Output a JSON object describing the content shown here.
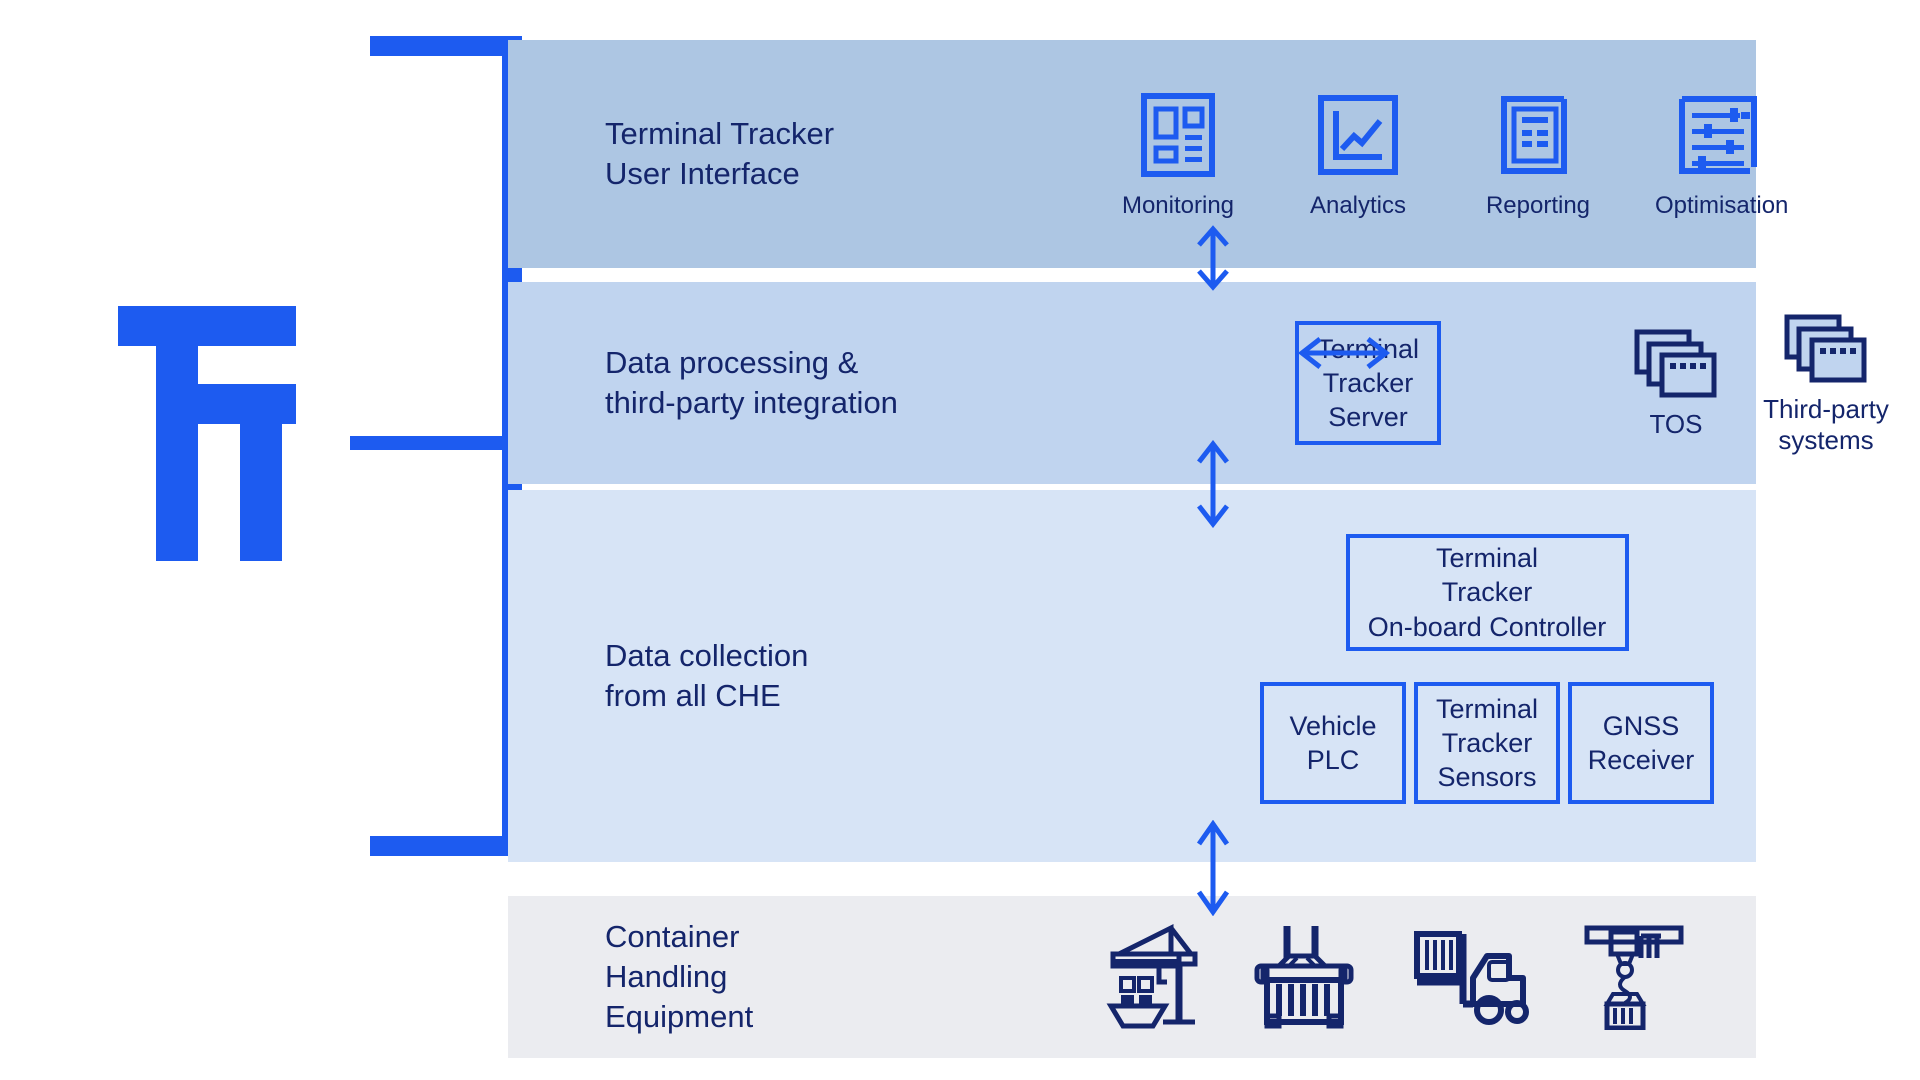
{
  "colors": {
    "brand_blue": "#1d5bf0",
    "navy": "#14256b",
    "band_ui": "#adc6e3",
    "band_processing": "#c0d4ef",
    "band_collection": "#d7e4f6",
    "band_che": "#ebecf0"
  },
  "logo": {
    "name": "terminal-tracker-tt-monogram"
  },
  "bands": {
    "ui": {
      "label": "Terminal Tracker\nUser Interface",
      "items": [
        {
          "icon": "dashboard-monitoring-icon",
          "label": "Monitoring"
        },
        {
          "icon": "line-chart-analytics-icon",
          "label": "Analytics"
        },
        {
          "icon": "document-reporting-icon",
          "label": "Reporting"
        },
        {
          "icon": "sliders-optimisation-icon",
          "label": "Optimisation"
        }
      ]
    },
    "processing": {
      "label": "Data processing &\nthird-party integration",
      "server_box": "Terminal\nTracker\nServer",
      "systems": [
        {
          "icon": "stacked-windows-icon",
          "label": "TOS"
        },
        {
          "icon": "stacked-windows-icon",
          "label": "Third-party\nsystems"
        }
      ]
    },
    "collection": {
      "label": "Data collection\nfrom all CHE",
      "controller_box": "Terminal\nTracker\nOn-board Controller",
      "devices": [
        "Vehicle\nPLC",
        "Terminal\nTracker\nSensors",
        "GNSS\nReceiver"
      ]
    },
    "che": {
      "label": "Container\nHandling\nEquipment",
      "items": [
        {
          "icon": "ship-to-shore-crane-icon"
        },
        {
          "icon": "container-spreader-icon"
        },
        {
          "icon": "forklift-reach-stacker-icon"
        },
        {
          "icon": "gantry-crane-container-icon"
        }
      ]
    }
  },
  "arrows": [
    {
      "name": "arrow-ui-to-processing",
      "direction": "bidirectional-vertical"
    },
    {
      "name": "arrow-processing-to-controller",
      "direction": "bidirectional-vertical"
    },
    {
      "name": "arrow-server-to-tos",
      "direction": "bidirectional-horizontal"
    },
    {
      "name": "arrow-sensors-to-che",
      "direction": "bidirectional-vertical"
    }
  ]
}
